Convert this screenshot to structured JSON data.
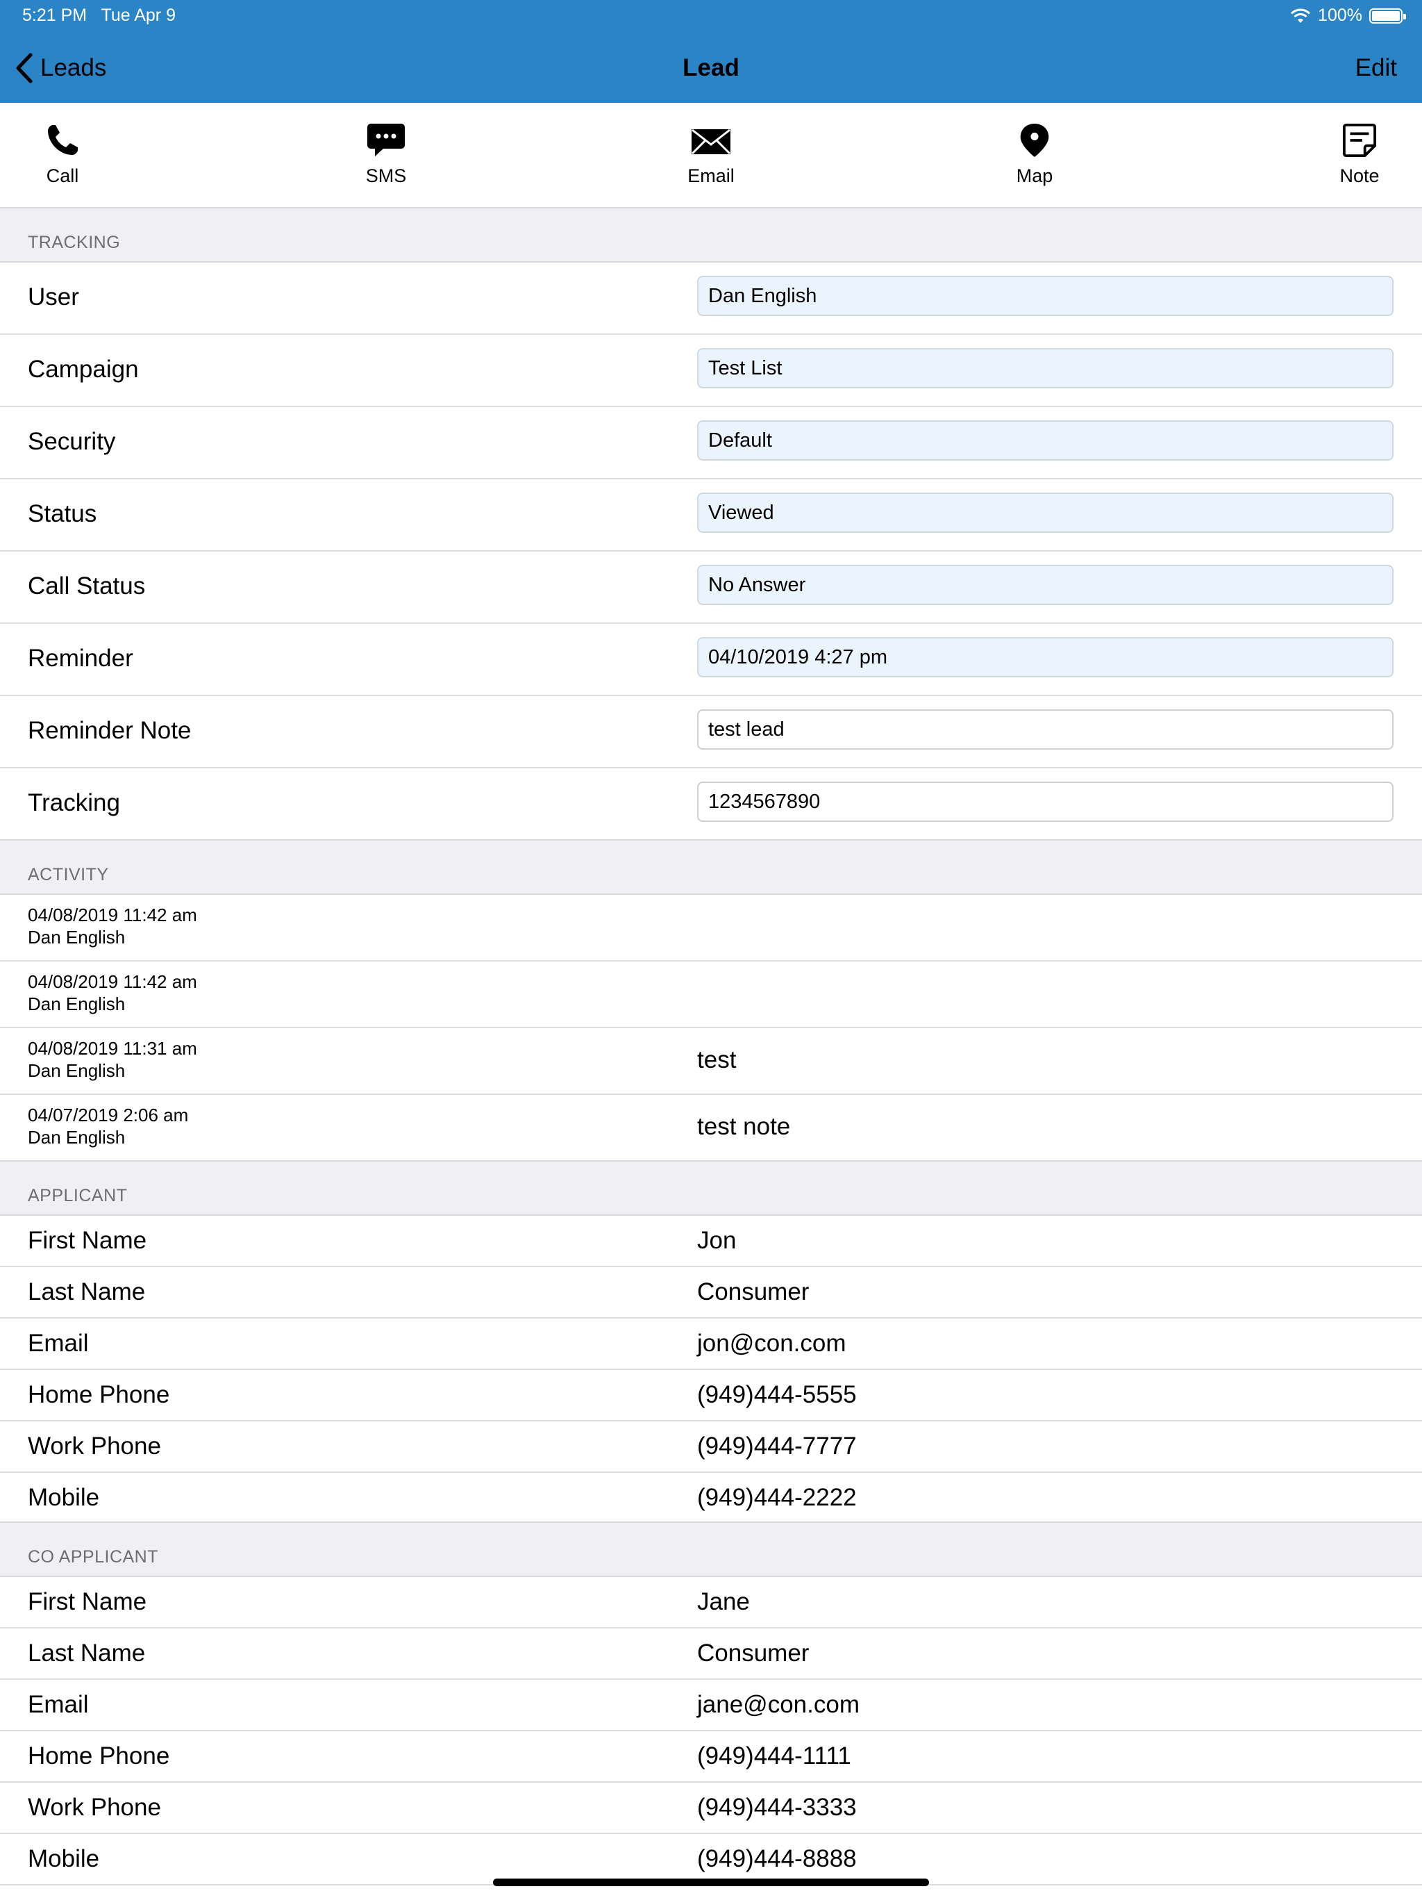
{
  "status_bar": {
    "time": "5:21 PM",
    "date": "Tue Apr 9",
    "battery": "100%",
    "battery_level": 1.0
  },
  "nav": {
    "back_label": "Leads",
    "title": "Lead",
    "edit_label": "Edit"
  },
  "toolbar": [
    {
      "label": "Call",
      "icon": "phone-icon"
    },
    {
      "label": "SMS",
      "icon": "chat-bubble-icon"
    },
    {
      "label": "Email",
      "icon": "envelope-icon"
    },
    {
      "label": "Map",
      "icon": "map-pin-icon"
    },
    {
      "label": "Note",
      "icon": "note-icon"
    }
  ],
  "tracking": {
    "header": "TRACKING",
    "rows": [
      {
        "label": "User",
        "value": "Dan English"
      },
      {
        "label": "Campaign",
        "value": "Test List"
      },
      {
        "label": "Security",
        "value": "Default"
      },
      {
        "label": "Status",
        "value": "Viewed"
      },
      {
        "label": "Call Status",
        "value": "No Answer"
      },
      {
        "label": "Reminder",
        "value": "04/10/2019 4:27 pm"
      },
      {
        "label": "Reminder Note",
        "value": "test lead"
      },
      {
        "label": "Tracking",
        "value": "1234567890"
      }
    ]
  },
  "activity": {
    "header": "ACTIVITY",
    "items": [
      {
        "date": "04/08/2019 11:42 am",
        "user": "Dan English",
        "text": ""
      },
      {
        "date": "04/08/2019 11:42 am",
        "user": "Dan English",
        "text": ""
      },
      {
        "date": "04/08/2019 11:31 am",
        "user": "Dan English",
        "text": "test"
      },
      {
        "date": "04/07/2019 2:06 am",
        "user": "Dan English",
        "text": "test note"
      }
    ]
  },
  "applicant": {
    "header": "APPLICANT",
    "rows": [
      {
        "label": "First Name",
        "value": "Jon"
      },
      {
        "label": "Last Name",
        "value": "Consumer"
      },
      {
        "label": "Email",
        "value": "jon@con.com"
      },
      {
        "label": "Home Phone",
        "value": "(949)444-5555"
      },
      {
        "label": "Work Phone",
        "value": "(949)444-7777"
      },
      {
        "label": "Mobile",
        "value": "(949)444-2222"
      }
    ]
  },
  "co_applicant": {
    "header": "CO APPLICANT",
    "rows": [
      {
        "label": "First Name",
        "value": "Jane"
      },
      {
        "label": "Last Name",
        "value": "Consumer"
      },
      {
        "label": "Email",
        "value": "jane@con.com"
      },
      {
        "label": "Home Phone",
        "value": "(949)444-1111"
      },
      {
        "label": "Work Phone",
        "value": "(949)444-3333"
      },
      {
        "label": "Mobile",
        "value": "(949)444-8888"
      }
    ]
  },
  "colors": {
    "nav_bar": "#2a84c5",
    "section_bg": "#efeff4",
    "field_bg": "#ebf4fd"
  }
}
